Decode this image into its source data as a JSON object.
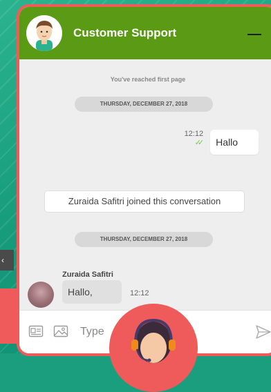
{
  "widget": {
    "title": "Customer Support",
    "first_page_notice": "You've reached first page",
    "date_separators": [
      "THURSDAY, DECEMBER 27, 2018",
      "THURSDAY, DECEMBER 27, 2018"
    ],
    "outgoing_message": {
      "time": "12:12",
      "text": "Hallo",
      "status_icon": "double-check-icon"
    },
    "system_note": "Zuraida Safitri joined this conversation",
    "incoming_message": {
      "sender": "Zuraida Safitri",
      "text": "Hallo,",
      "time": "12:12"
    },
    "input": {
      "placeholder": "Type"
    }
  },
  "side_tab": {
    "label": "‹"
  },
  "colors": {
    "header": "#5a9a14",
    "accent": "#ef5b5b",
    "background": "#1a9e7e",
    "check": "#7ac943"
  }
}
